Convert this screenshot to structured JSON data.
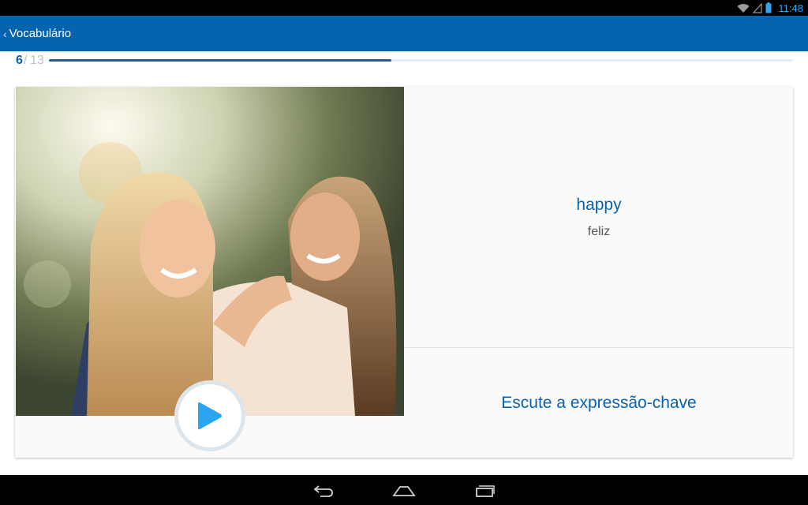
{
  "status_bar": {
    "time": "11:48"
  },
  "app_bar": {
    "title": "Vocabulário"
  },
  "progress": {
    "current": "6",
    "separator": "/",
    "total": "13",
    "fraction": 0.46
  },
  "card": {
    "image_alt": "two women laughing outdoors",
    "word": "happy",
    "translation": "feliz",
    "listen_label": "Escute a expressão-chave"
  },
  "colors": {
    "brand": "#0563b0",
    "play": "#2aa5f2"
  }
}
